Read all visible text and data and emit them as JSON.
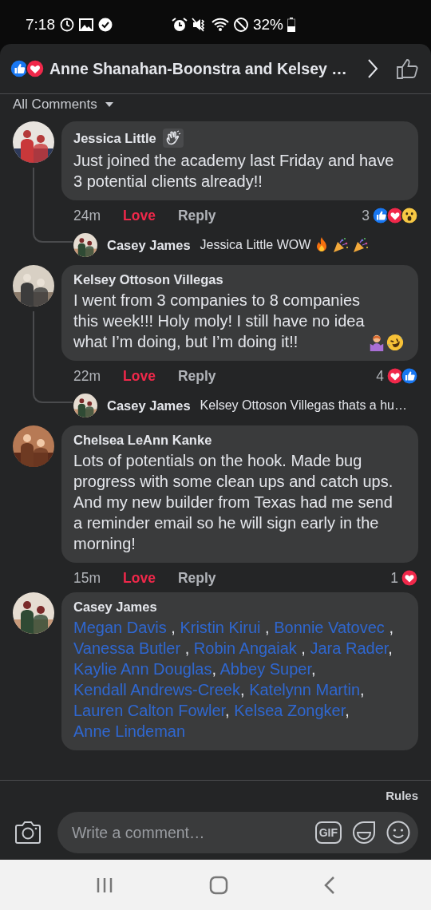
{
  "status_bar": {
    "time": "7:18",
    "battery": "32%"
  },
  "header": {
    "reactions": [
      {
        "kind": "like"
      },
      {
        "kind": "love"
      }
    ],
    "title": "Anne Shanahan-Boonstra and Kelsey …"
  },
  "filter": {
    "label": "All Comments"
  },
  "comments": [
    {
      "author": "Jessica Little",
      "badge": {
        "kind": "wave"
      },
      "text": "Just joined the academy last Friday and have 3 potential clients already!!",
      "time": "24m",
      "action": {
        "label": "Love",
        "reacted": true
      },
      "reply_label": "Reply",
      "reaction_count": "3",
      "reactions": [
        {
          "kind": "like"
        },
        {
          "kind": "love"
        },
        {
          "kind": "wow"
        }
      ],
      "replies": [
        {
          "author": "Casey James",
          "text": "Jessica Little WOW",
          "emojis": [
            {
              "kind": "fire"
            },
            {
              "kind": "party"
            },
            {
              "kind": "party"
            }
          ]
        }
      ]
    },
    {
      "author": "Kelsey Ottoson Villegas",
      "text": "I went from 3 companies to 8 companies this week!!! Holy moly! I still have no idea what I’m doing, but I’m doing it!!",
      "emojis": [
        {
          "kind": "shrug"
        },
        {
          "kind": "laugh"
        }
      ],
      "time": "22m",
      "action": {
        "label": "Love",
        "reacted": true
      },
      "reply_label": "Reply",
      "reaction_count": "4",
      "reactions": [
        {
          "kind": "love"
        },
        {
          "kind": "like"
        }
      ],
      "replies": [
        {
          "author": "Casey James",
          "text": "Kelsey Ottoson Villegas thats a hu…"
        }
      ]
    },
    {
      "author": "Chelsea LeAnn Kanke",
      "text": "Lots of potentials on the hook. Made bug progress with some clean ups and catch ups. And my new builder from Texas had me send a reminder email so he will sign early in the morning!",
      "time": "15m",
      "action": {
        "label": "Love",
        "reacted": true
      },
      "reply_label": "Reply",
      "reaction_count": "1",
      "reactions": [
        {
          "kind": "love"
        }
      ]
    },
    {
      "author": "Casey James",
      "segments": [
        {
          "kind": "mention",
          "text": "Megan Davis"
        },
        {
          "kind": "text",
          "text": " , "
        },
        {
          "kind": "mention",
          "text": "Kristin Kirui"
        },
        {
          "kind": "text",
          "text": " , "
        },
        {
          "kind": "mention",
          "text": "Bonnie Vatovec"
        },
        {
          "kind": "text",
          "text": " , "
        },
        {
          "kind": "mention",
          "text": "Vanessa Butler"
        },
        {
          "kind": "text",
          "text": " , "
        },
        {
          "kind": "mention",
          "text": "Robin Angaiak"
        },
        {
          "kind": "text",
          "text": " , "
        },
        {
          "kind": "mention",
          "text": "Jara Rader"
        },
        {
          "kind": "text",
          "text": ", "
        },
        {
          "kind": "mention",
          "text": "Kaylie Ann Douglas"
        },
        {
          "kind": "text",
          "text": ", "
        },
        {
          "kind": "mention",
          "text": "Abbey Super"
        },
        {
          "kind": "text",
          "text": ", "
        },
        {
          "kind": "mention",
          "text": "Kendall Andrews-Creek"
        },
        {
          "kind": "text",
          "text": ", "
        },
        {
          "kind": "mention",
          "text": "Katelynn Martin"
        },
        {
          "kind": "text",
          "text": ", "
        },
        {
          "kind": "mention",
          "text": "Lauren Calton Fowler"
        },
        {
          "kind": "text",
          "text": ", "
        },
        {
          "kind": "mention",
          "text": "Kelsea Zongker"
        },
        {
          "kind": "text",
          "text": ", "
        },
        {
          "kind": "mention",
          "text": "Anne Lindeman"
        }
      ]
    }
  ],
  "composer": {
    "rules": "Rules",
    "placeholder": "Write a comment…",
    "gif": "GIF"
  }
}
